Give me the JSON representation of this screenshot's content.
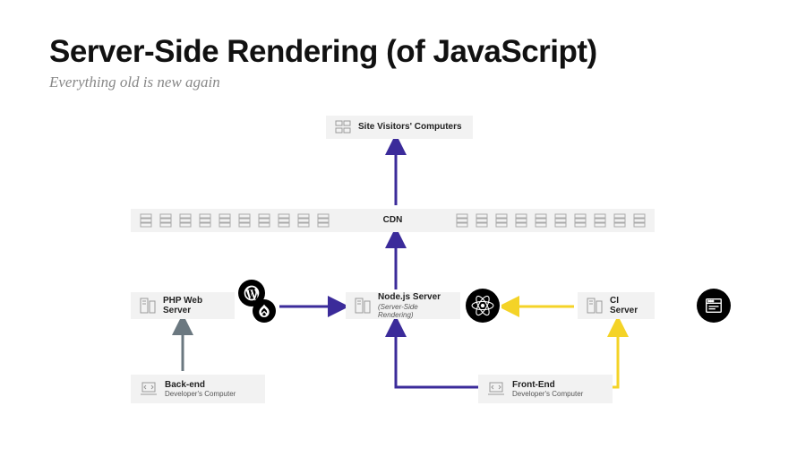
{
  "title": "Server-Side Rendering (of JavaScript)",
  "subtitle": "Everything old is new again",
  "boxes": {
    "visitors": {
      "label": "Site Visitors' Computers"
    },
    "cdn": {
      "label": "CDN"
    },
    "php": {
      "label": "PHP Web Server"
    },
    "node": {
      "label": "Node.js Server",
      "sublabel": "(Server-Side Rendering)"
    },
    "ci": {
      "label": "CI Server"
    },
    "backend": {
      "label": "Back-end",
      "sublabel": "Developer's Computer"
    },
    "frontend": {
      "label": "Front-End",
      "sublabel": "Developer's Computer"
    }
  },
  "icons": {
    "wordpress": "wordpress-icon",
    "drupal": "drupal-icon",
    "react": "react-icon",
    "website": "website-icon"
  },
  "arrows": {
    "node_to_cdn": {
      "color": "#3b2b9a"
    },
    "cdn_to_visitors": {
      "color": "#3b2b9a"
    },
    "php_to_node": {
      "color": "#3b2b9a"
    },
    "frontend_to_node": {
      "color": "#3b2b9a"
    },
    "backend_to_php": {
      "color": "#6b7880"
    },
    "ci_to_node": {
      "color": "#f4d327"
    },
    "frontend_to_ci": {
      "color": "#f4d327"
    }
  }
}
